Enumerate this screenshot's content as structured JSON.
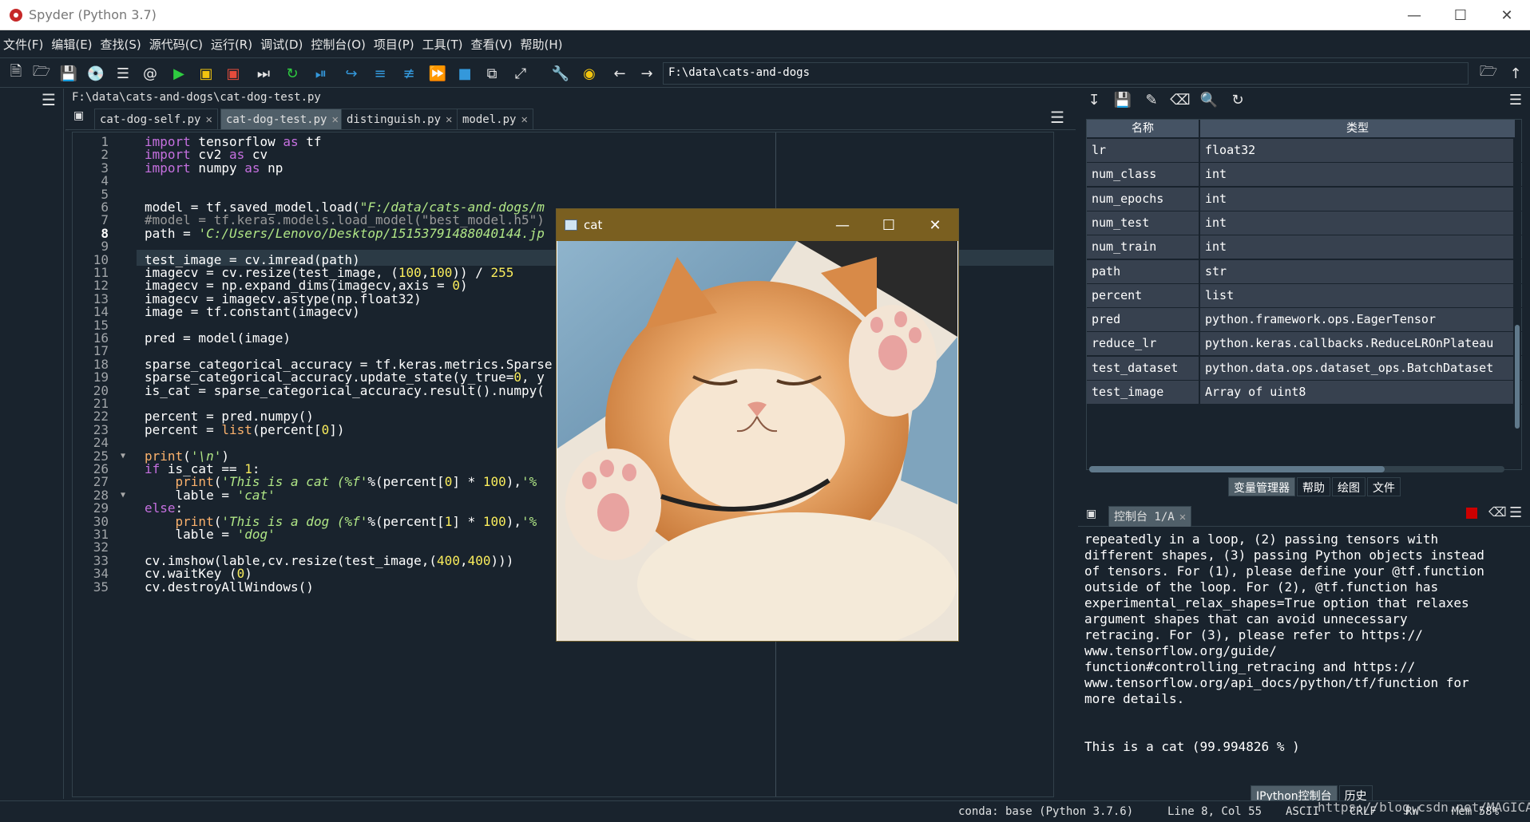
{
  "window": {
    "title": "Spyder (Python 3.7)"
  },
  "menu": [
    "文件(F)",
    "编辑(E)",
    "查找(S)",
    "源代码(C)",
    "运行(R)",
    "调试(D)",
    "控制台(O)",
    "项目(P)",
    "工具(T)",
    "查看(V)",
    "帮助(H)"
  ],
  "toolbar": {
    "path": "F:\\data\\cats-and-dogs"
  },
  "editor": {
    "file_path": "F:\\data\\cats-and-dogs\\cat-dog-test.py",
    "tabs": [
      "cat-dog-self.py",
      "cat-dog-test.py",
      "distinguish.py",
      "model.py"
    ],
    "active_tab": 1,
    "current_line": 8,
    "lines": [
      "import tensorflow as tf",
      "import cv2 as cv",
      "import numpy as np",
      "",
      "",
      "model = tf.saved_model.load(\"F:/data/cats-and-dogs/m",
      "#model = tf.keras.models.load_model(\"best_model.h5\")",
      "path = 'C:/Users/Lenovo/Desktop/15153791488040144.jp",
      "",
      "test_image = cv.imread(path)",
      "imagecv = cv.resize(test_image, (100,100)) / 255",
      "imagecv = np.expand_dims(imagecv,axis = 0)",
      "imagecv = imagecv.astype(np.float32)",
      "image = tf.constant(imagecv)",
      "",
      "pred = model(image)",
      "",
      "sparse_categorical_accuracy = tf.keras.metrics.Sparse",
      "sparse_categorical_accuracy.update_state(y_true=0, y",
      "is_cat = sparse_categorical_accuracy.result().numpy(",
      "",
      "percent = pred.numpy()",
      "percent = list(percent[0])",
      "",
      "print('\\n')",
      "if is_cat == 1:",
      "    print('This is a cat (%f'%(percent[0] * 100),'%",
      "    lable = 'cat'",
      "else:",
      "    print('This is a dog (%f'%(percent[1] * 100),'%",
      "    lable = 'dog'",
      "",
      "cv.imshow(lable,cv.resize(test_image,(400,400)))",
      "cv.waitKey (0)",
      "cv.destroyAllWindows()"
    ]
  },
  "variables": {
    "headers": [
      "名称",
      "类型"
    ],
    "rows": [
      {
        "name": "lr",
        "type": "float32"
      },
      {
        "name": "num_class",
        "type": "int"
      },
      {
        "name": "num_epochs",
        "type": "int"
      },
      {
        "name": "num_test",
        "type": "int"
      },
      {
        "name": "num_train",
        "type": "int"
      },
      {
        "name": "path",
        "type": "str"
      },
      {
        "name": "percent",
        "type": "list"
      },
      {
        "name": "pred",
        "type": "python.framework.ops.EagerTensor"
      },
      {
        "name": "reduce_lr",
        "type": "python.keras.callbacks.ReduceLROnPlateau"
      },
      {
        "name": "test_dataset",
        "type": "python.data.ops.dataset_ops.BatchDataset"
      },
      {
        "name": "test_image",
        "type": "Array of uint8"
      }
    ],
    "tabs": [
      "变量管理器",
      "帮助",
      "绘图",
      "文件"
    ]
  },
  "console": {
    "tab": "控制台 1/A",
    "text": "repeatedly in a loop, (2) passing tensors with\ndifferent shapes, (3) passing Python objects instead\nof tensors. For (1), please define your @tf.function\noutside of the loop. For (2), @tf.function has\nexperimental_relax_shapes=True option that relaxes\nargument shapes that can avoid unnecessary\nretracing. For (3), please refer to https://\nwww.tensorflow.org/guide/\nfunction#controlling_retracing and https://\nwww.tensorflow.org/api_docs/python/tf/function for\nmore details.\n\n\nThis is a cat (99.994826 % )",
    "tabs": [
      "IPython控制台",
      "历史"
    ]
  },
  "status": {
    "conda": "conda: base (Python 3.7.6)",
    "position": "Line 8, Col 55",
    "encoding": "ASCII",
    "eol": "CRLF",
    "rw": "RW",
    "mem": "Mem 58%",
    "watermark": "https://blog.csdn.net/MAGICAL_CAT"
  },
  "image_window": {
    "title": "cat"
  }
}
